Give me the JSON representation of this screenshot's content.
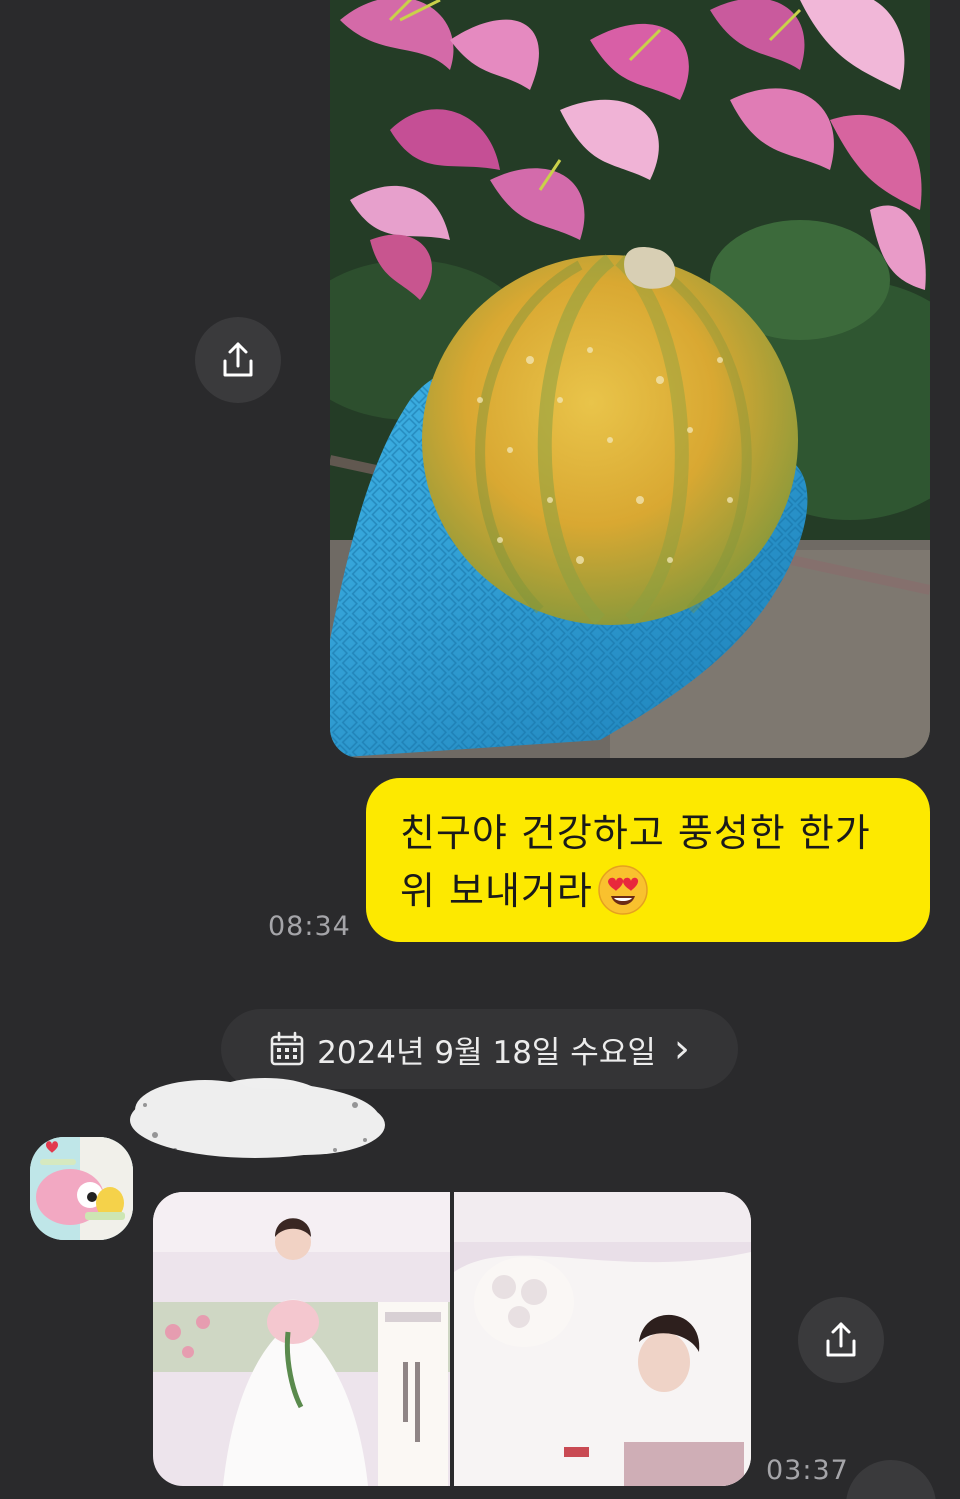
{
  "messages": {
    "outgoing": {
      "text_line1": "친구야 건강하고 풍성한 한가",
      "text_line2": "위 보내거라",
      "emoji": "heart-eyes-emoji",
      "time": "08:34"
    },
    "date_separator": {
      "label": "2024년 9월 18일 수요일",
      "icon": "calendar-icon",
      "chevron": "›"
    },
    "incoming": {
      "time": "03:37"
    }
  },
  "icons": {
    "share": "share-icon"
  },
  "colors": {
    "background": "#2a2a2c",
    "bubble_outgoing": "#fde900",
    "share_button": "#3a3a3c",
    "timestamp": "#a5a5a9",
    "date_pill": "#343436"
  }
}
